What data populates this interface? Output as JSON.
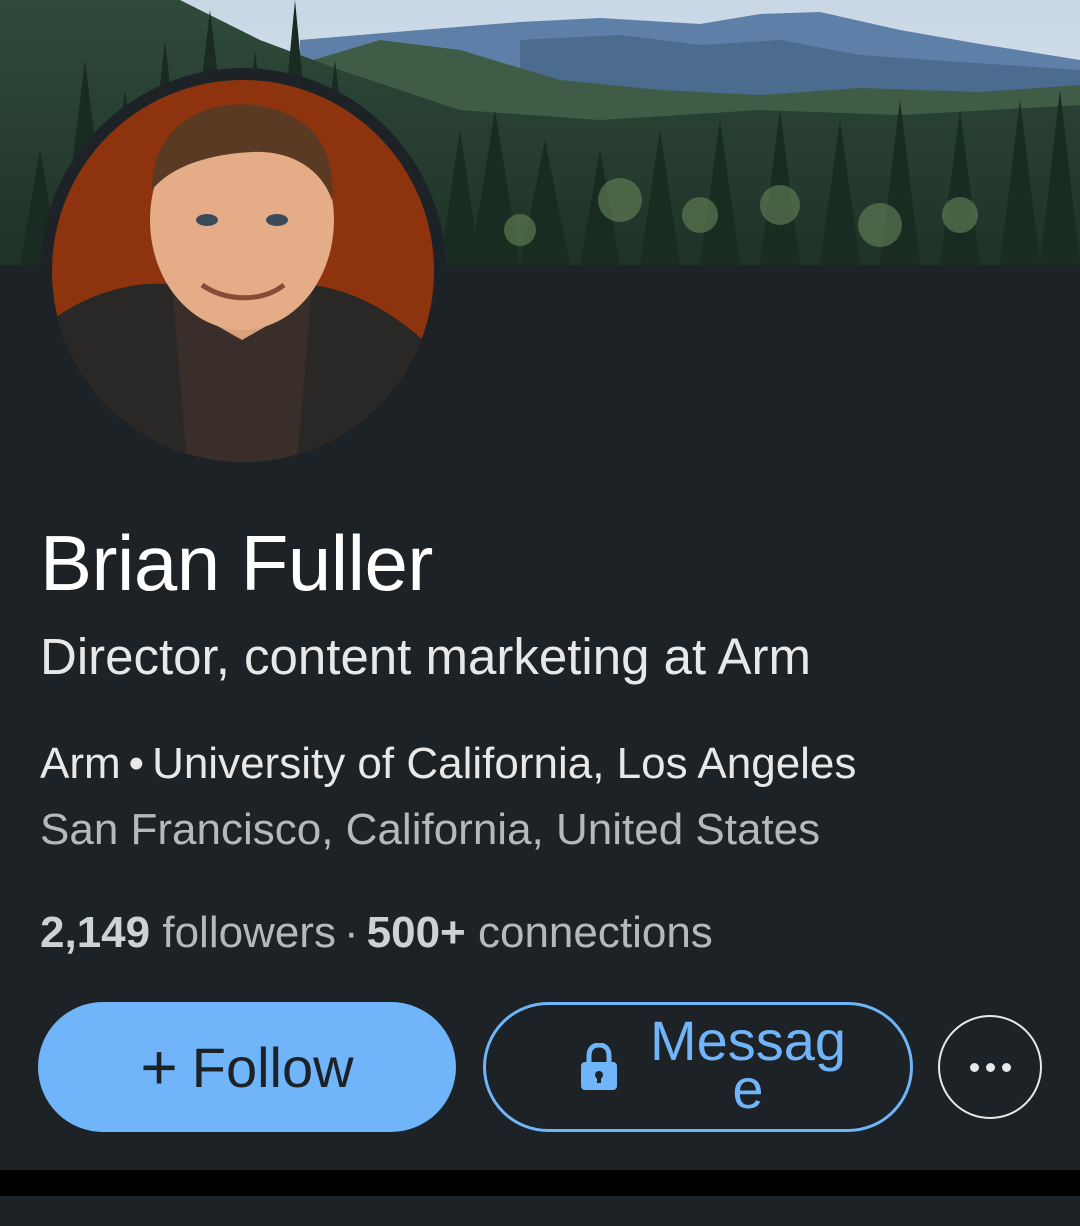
{
  "profile": {
    "name": "Brian Fuller",
    "headline": "Director, content marketing at Arm",
    "company": "Arm",
    "education_separator": "•",
    "school": "University of California, Los Angeles",
    "location": "San Francisco, California, United States",
    "followers_count": "2,149",
    "followers_label": "followers",
    "stats_separator": "·",
    "connections_count": "500+",
    "connections_label": "connections"
  },
  "actions": {
    "follow_icon": "+",
    "follow_label": "Follow",
    "message_label": "Message",
    "message_icon": "lock-icon",
    "more_icon": "more-horizontal-icon"
  },
  "colors": {
    "background": "#1d2226",
    "accent": "#70b5f9",
    "text_primary": "#ffffff",
    "text_secondary": "#b6b9bb"
  },
  "images": {
    "cover": "forest-mountain-landscape",
    "avatar": "profile-photo"
  }
}
